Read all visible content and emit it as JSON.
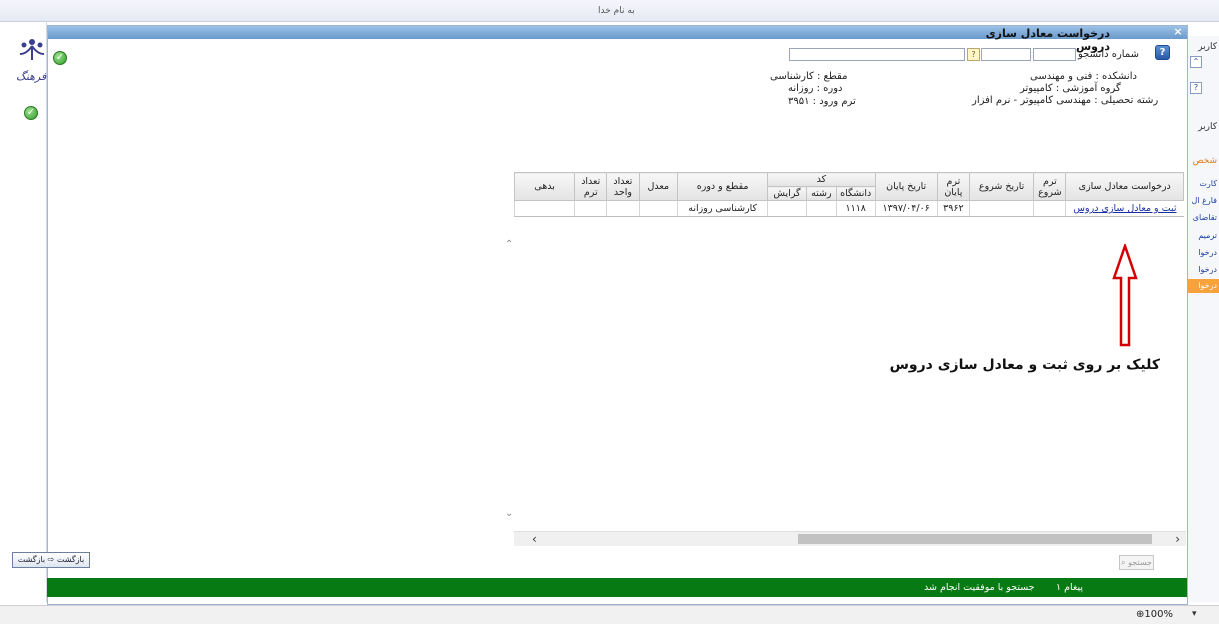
{
  "browser": {
    "top_title": "به نام خدا",
    "zoom": "100%"
  },
  "dialog": {
    "title": "درخواست معادل سازی دروس",
    "close_glyph": "×",
    "student_label": "شماره دانشجو"
  },
  "info": {
    "faculty": "دانشکده : فنی و مهندسی",
    "department": "گروه آموزشی : کامپیوتر",
    "major": "رشته تحصیلی : مهندسی کامپیوتر - نرم افزار",
    "degree": "مقطع : کارشناسی",
    "course_type": "دوره : روزانه",
    "entry_term": "ترم ورود : ۳۹۵۱"
  },
  "grid": {
    "headers": {
      "request": "درخواست معادل سازی",
      "start_term": "ترم شروع",
      "start_date": "تاریخ شروع",
      "end_term": "ترم پایان",
      "end_date": "تاریخ پایان",
      "code": "کد",
      "university": "دانشگاه",
      "field": "رشته",
      "orientation": "گرایش",
      "level": "مقطع و دوره",
      "gpa": "معدل",
      "units": "تعداد واحد",
      "terms": "تعداد ترم",
      "debt": "بدهی"
    },
    "row": {
      "request": "ثبت و معادل سازی دروس",
      "start_term": "",
      "start_date": "",
      "end_term": "۳۹۶۲",
      "end_date": "۱۳۹۷/۰۴/۰۶",
      "university": "۱۱۱۸",
      "field": "",
      "orientation": "",
      "level": "کارشناسی روزانه",
      "gpa": "",
      "units": "",
      "terms": "",
      "debt": ""
    }
  },
  "annotation": "کلیک بر روی ثبت و معادل سازی دروس",
  "buttons": {
    "search": "جستجو",
    "back": "بازگشت",
    "back2": "بازگشت"
  },
  "status": {
    "count": "۱ پیغام",
    "message": "جستجو با موفقیت انجام شد"
  },
  "right_panel": {
    "label_top": "کاربر",
    "label_mid": "کاربر",
    "label_personal": "شخص",
    "items": [
      "کارت",
      "فارغ ال",
      "تقاضای",
      "ترمیم",
      "درخوا",
      "درخوا",
      "درخوا"
    ]
  },
  "logo_text": "فرهنگ"
}
